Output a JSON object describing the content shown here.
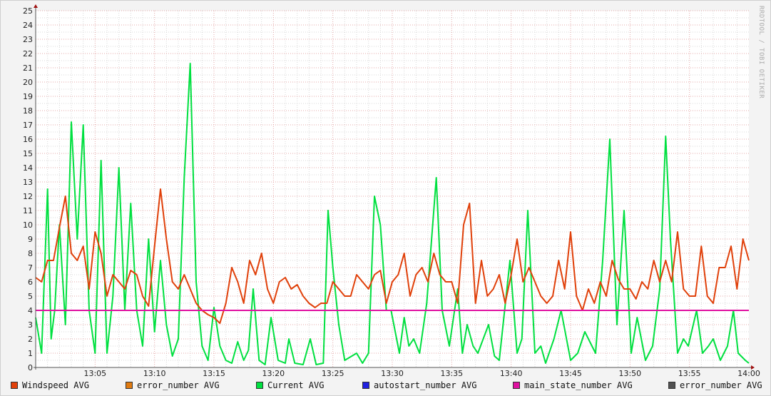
{
  "watermark": "RRDTOOL / TOBI OETIKER",
  "chart_data": {
    "type": "line",
    "title": "",
    "xlabel": "",
    "ylabel": "",
    "xlim_minutes_after_13_00": [
      0,
      60
    ],
    "ylim": [
      0,
      25
    ],
    "y_ticks": [
      "0",
      "1",
      "2",
      "3",
      "4",
      "5",
      "6",
      "7",
      "8",
      "9",
      "10",
      "11",
      "12",
      "13",
      "14",
      "15",
      "16",
      "17",
      "18",
      "19",
      "20",
      "21",
      "22",
      "23",
      "24",
      "25"
    ],
    "x_ticks": [
      {
        "t": 5,
        "label": "13:05"
      },
      {
        "t": 10,
        "label": "13:10"
      },
      {
        "t": 15,
        "label": "13:15"
      },
      {
        "t": 20,
        "label": "13:20"
      },
      {
        "t": 25,
        "label": "13:25"
      },
      {
        "t": 30,
        "label": "13:30"
      },
      {
        "t": 35,
        "label": "13:35"
      },
      {
        "t": 40,
        "label": "13:40"
      },
      {
        "t": 45,
        "label": "13:45"
      },
      {
        "t": 50,
        "label": "13:50"
      },
      {
        "t": 55,
        "label": "13:55"
      },
      {
        "t": 60,
        "label": "14:00"
      }
    ],
    "grid": true,
    "legend_position": "bottom",
    "legend": [
      {
        "name": "Windspeed AVG",
        "color": "#e0400a"
      },
      {
        "name": "error_number AVG",
        "color": "#e07a10"
      },
      {
        "name": "Current AVG",
        "color": "#00e040"
      },
      {
        "name": "autostart_number AVG",
        "color": "#2020e0"
      },
      {
        "name": "main_state_number AVG",
        "color": "#e010a0"
      },
      {
        "name": "error_number AVG",
        "color": "#505050"
      }
    ],
    "series": [
      {
        "name": "Current AVG",
        "color": "#00e040",
        "points": [
          [
            0,
            3.5
          ],
          [
            0.5,
            1
          ],
          [
            1,
            12.5
          ],
          [
            1.3,
            2
          ],
          [
            1.6,
            4
          ],
          [
            2,
            10
          ],
          [
            2.5,
            3
          ],
          [
            3,
            17.2
          ],
          [
            3.5,
            9
          ],
          [
            4,
            17
          ],
          [
            4.5,
            4
          ],
          [
            5,
            1
          ],
          [
            5.5,
            14.5
          ],
          [
            6,
            1
          ],
          [
            6.5,
            5
          ],
          [
            7,
            14
          ],
          [
            7.5,
            4
          ],
          [
            8,
            11.5
          ],
          [
            8.5,
            4
          ],
          [
            9,
            1.5
          ],
          [
            9.5,
            9
          ],
          [
            10,
            2.5
          ],
          [
            10.5,
            7.5
          ],
          [
            11,
            3
          ],
          [
            11.5,
            0.8
          ],
          [
            12,
            2
          ],
          [
            12.5,
            13.3
          ],
          [
            13,
            21.3
          ],
          [
            13.5,
            6
          ],
          [
            14,
            1.5
          ],
          [
            14.5,
            0.5
          ],
          [
            15,
            4.2
          ],
          [
            15.5,
            1.5
          ],
          [
            16,
            0.5
          ],
          [
            16.5,
            0.3
          ],
          [
            17,
            1.8
          ],
          [
            17.5,
            0.5
          ],
          [
            17.9,
            1.2
          ],
          [
            18.3,
            5.5
          ],
          [
            18.8,
            0.5
          ],
          [
            19.3,
            0.2
          ],
          [
            19.8,
            3.5
          ],
          [
            20.4,
            0.5
          ],
          [
            21,
            0.3
          ],
          [
            21.3,
            2
          ],
          [
            21.8,
            0.3
          ],
          [
            22.5,
            0.2
          ],
          [
            23.1,
            2
          ],
          [
            23.6,
            0.2
          ],
          [
            24.2,
            0.3
          ],
          [
            24.6,
            11
          ],
          [
            25,
            7
          ],
          [
            25.5,
            3
          ],
          [
            26,
            0.5
          ],
          [
            27,
            1
          ],
          [
            27.5,
            0.3
          ],
          [
            28,
            1
          ],
          [
            28.5,
            12
          ],
          [
            29,
            10
          ],
          [
            29.5,
            4
          ],
          [
            29.9,
            4
          ],
          [
            30.6,
            1
          ],
          [
            31,
            3.5
          ],
          [
            31.4,
            1.5
          ],
          [
            31.8,
            2
          ],
          [
            32.3,
            1
          ],
          [
            32.9,
            4.5
          ],
          [
            33.7,
            13.3
          ],
          [
            34.2,
            4
          ],
          [
            34.8,
            1.5
          ],
          [
            35.5,
            5.5
          ],
          [
            35.9,
            1
          ],
          [
            36.3,
            3
          ],
          [
            36.8,
            1.5
          ],
          [
            37.2,
            1
          ],
          [
            38.1,
            3
          ],
          [
            38.6,
            0.8
          ],
          [
            39,
            0.5
          ],
          [
            39.9,
            7.5
          ],
          [
            40.5,
            1
          ],
          [
            40.9,
            2
          ],
          [
            41.4,
            11
          ],
          [
            42,
            1
          ],
          [
            42.5,
            1.5
          ],
          [
            42.9,
            0.3
          ],
          [
            43.6,
            2
          ],
          [
            44.2,
            4
          ],
          [
            45,
            0.5
          ],
          [
            45.6,
            1
          ],
          [
            46.2,
            2.5
          ],
          [
            47.1,
            1
          ],
          [
            47.7,
            7.5
          ],
          [
            48.3,
            16
          ],
          [
            48.9,
            3
          ],
          [
            49.5,
            11
          ],
          [
            50.1,
            1
          ],
          [
            50.6,
            3.5
          ],
          [
            51.3,
            0.5
          ],
          [
            51.9,
            1.5
          ],
          [
            52.5,
            5.5
          ],
          [
            53,
            16.2
          ],
          [
            53.4,
            9
          ],
          [
            54,
            1
          ],
          [
            54.5,
            2
          ],
          [
            54.9,
            1.5
          ],
          [
            55.6,
            4
          ],
          [
            56.1,
            1
          ],
          [
            56.6,
            1.5
          ],
          [
            57,
            2
          ],
          [
            57.6,
            0.5
          ],
          [
            58.2,
            1.5
          ],
          [
            58.7,
            4
          ],
          [
            59.1,
            1
          ],
          [
            59.7,
            0.5
          ],
          [
            60,
            0.3
          ]
        ]
      },
      {
        "name": "Windspeed AVG",
        "color": "#e0400a",
        "points": [
          [
            0,
            6.3
          ],
          [
            0.5,
            6
          ],
          [
            1,
            7.5
          ],
          [
            1.5,
            7.5
          ],
          [
            2,
            9.8
          ],
          [
            2.5,
            12
          ],
          [
            3,
            8
          ],
          [
            3.5,
            7.5
          ],
          [
            4,
            8.5
          ],
          [
            4.5,
            5.5
          ],
          [
            5,
            9.5
          ],
          [
            5.5,
            8
          ],
          [
            6,
            5
          ],
          [
            6.5,
            6.5
          ],
          [
            7,
            6
          ],
          [
            7.5,
            5.5
          ],
          [
            8,
            6.8
          ],
          [
            8.5,
            6.5
          ],
          [
            9,
            5
          ],
          [
            9.5,
            4.3
          ],
          [
            10,
            8.5
          ],
          [
            10.5,
            12.5
          ],
          [
            11,
            9
          ],
          [
            11.5,
            6
          ],
          [
            12,
            5.5
          ],
          [
            12.5,
            6.5
          ],
          [
            13,
            5.5
          ],
          [
            13.5,
            4.5
          ],
          [
            14,
            4
          ],
          [
            14.5,
            3.7
          ],
          [
            15,
            3.5
          ],
          [
            15.5,
            3.1
          ],
          [
            16,
            4.5
          ],
          [
            16.5,
            7
          ],
          [
            17,
            6
          ],
          [
            17.5,
            4.5
          ],
          [
            18,
            7.5
          ],
          [
            18.5,
            6.5
          ],
          [
            19,
            8
          ],
          [
            19.5,
            5.5
          ],
          [
            20,
            4.5
          ],
          [
            20.5,
            6
          ],
          [
            21,
            6.3
          ],
          [
            21.5,
            5.5
          ],
          [
            22,
            5.8
          ],
          [
            22.5,
            5
          ],
          [
            23,
            4.5
          ],
          [
            23.5,
            4.2
          ],
          [
            24,
            4.5
          ],
          [
            24.5,
            4.5
          ],
          [
            25,
            6
          ],
          [
            25.5,
            5.5
          ],
          [
            26,
            5
          ],
          [
            26.5,
            5
          ],
          [
            27,
            6.5
          ],
          [
            27.5,
            6
          ],
          [
            28,
            5.5
          ],
          [
            28.5,
            6.5
          ],
          [
            29,
            6.8
          ],
          [
            29.5,
            4.5
          ],
          [
            30,
            6
          ],
          [
            30.5,
            6.5
          ],
          [
            31,
            8
          ],
          [
            31.5,
            5
          ],
          [
            32,
            6.5
          ],
          [
            32.5,
            7
          ],
          [
            33,
            6
          ],
          [
            33.5,
            8
          ],
          [
            34,
            6.5
          ],
          [
            34.5,
            6
          ],
          [
            35,
            6
          ],
          [
            35.5,
            4.5
          ],
          [
            36,
            10
          ],
          [
            36.5,
            11.5
          ],
          [
            37,
            4.5
          ],
          [
            37.5,
            7.5
          ],
          [
            38,
            5
          ],
          [
            38.5,
            5.5
          ],
          [
            39,
            6.5
          ],
          [
            39.5,
            4.5
          ],
          [
            40,
            6.5
          ],
          [
            40.5,
            9
          ],
          [
            41,
            6
          ],
          [
            41.5,
            7
          ],
          [
            42,
            6
          ],
          [
            42.5,
            5
          ],
          [
            43,
            4.5
          ],
          [
            43.5,
            5
          ],
          [
            44,
            7.5
          ],
          [
            44.5,
            5.5
          ],
          [
            45,
            9.5
          ],
          [
            45.5,
            5
          ],
          [
            46,
            4
          ],
          [
            46.5,
            5.5
          ],
          [
            47,
            4.5
          ],
          [
            47.5,
            6
          ],
          [
            48,
            5
          ],
          [
            48.5,
            7.5
          ],
          [
            49,
            6.2
          ],
          [
            49.5,
            5.5
          ],
          [
            50,
            5.5
          ],
          [
            50.5,
            4.8
          ],
          [
            51,
            6
          ],
          [
            51.5,
            5.5
          ],
          [
            52,
            7.5
          ],
          [
            52.5,
            6
          ],
          [
            53,
            7.5
          ],
          [
            53.5,
            6
          ],
          [
            54,
            9.5
          ],
          [
            54.5,
            5.5
          ],
          [
            55,
            5
          ],
          [
            55.5,
            5
          ],
          [
            56,
            8.5
          ],
          [
            56.5,
            5
          ],
          [
            57,
            4.5
          ],
          [
            57.5,
            7
          ],
          [
            58,
            7
          ],
          [
            58.5,
            8.5
          ],
          [
            59,
            5.5
          ],
          [
            59.5,
            9
          ],
          [
            60,
            7.5
          ]
        ]
      },
      {
        "name": "main_state_number AVG",
        "color": "#e010a0",
        "points": [
          [
            0,
            4
          ],
          [
            60,
            4
          ]
        ]
      }
    ]
  }
}
